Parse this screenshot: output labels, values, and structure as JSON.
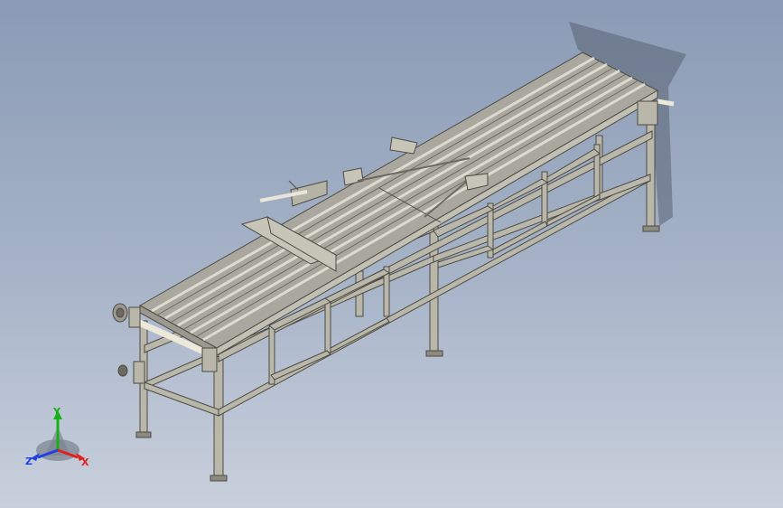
{
  "viewport": {
    "model": "roller-conveyor-table",
    "background_top": "#8a9bb5",
    "background_bottom": "#c9d0dc",
    "frame_color": "#b9b6aa",
    "deck_color": "#a9a79e"
  },
  "triad": {
    "x_label": "X",
    "y_label": "Y",
    "z_label": "Z",
    "x_color": "#e02020",
    "y_color": "#18b018",
    "z_color": "#2040e0"
  }
}
